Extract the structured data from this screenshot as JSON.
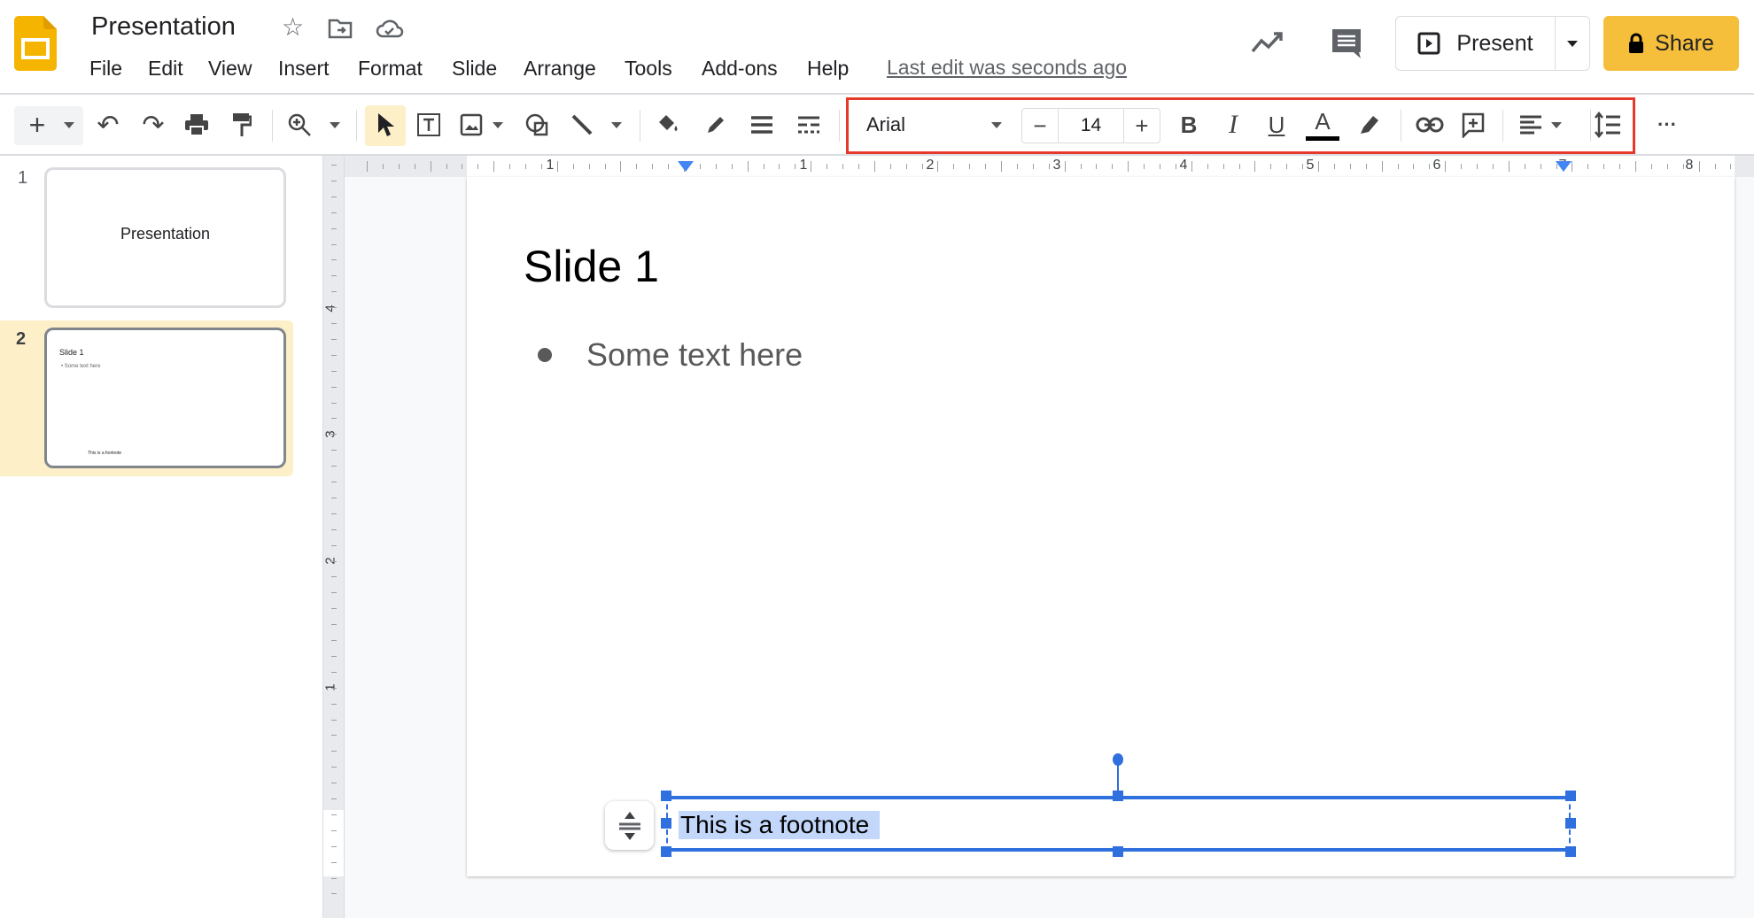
{
  "app": {
    "title": "Presentation",
    "last_edit": "Last edit was seconds ago"
  },
  "menu": [
    "File",
    "Edit",
    "View",
    "Insert",
    "Format",
    "Slide",
    "Arrange",
    "Tools",
    "Add-ons",
    "Help"
  ],
  "header_buttons": {
    "present": "Present",
    "share": "Share"
  },
  "toolbar": {
    "font": "Arial",
    "font_size": "14",
    "bold": "B",
    "italic": "I",
    "underline": "U",
    "text_color_glyph": "A",
    "text_color": "#000000",
    "more": "···"
  },
  "colors": {
    "brand": "#f4b400",
    "share": "#f6bf3b",
    "selection": "#2f6fde",
    "highlight": "#c2d7f9",
    "active_slide": "#fdefc8",
    "toolbar_focus_box": "#e53a2b"
  },
  "slides": [
    {
      "number": "1",
      "title": "Presentation"
    },
    {
      "number": "2",
      "title": "Slide 1",
      "bullet": "Some text here",
      "footnote": "This is a footnote"
    }
  ],
  "current_slide": {
    "title": "Slide 1",
    "bullets": [
      "Some text here"
    ],
    "footnote": "This is a footnote"
  },
  "rulers": {
    "horizontal": [
      "1",
      "1",
      "2",
      "3",
      "4",
      "5",
      "6",
      "7",
      "8"
    ],
    "vertical": [
      "4",
      "3",
      "2",
      "1"
    ]
  }
}
